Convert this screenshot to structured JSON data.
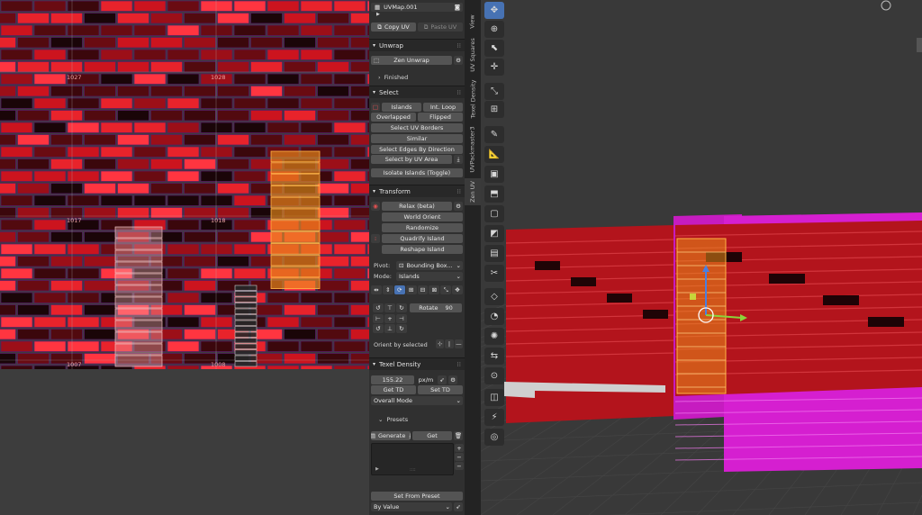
{
  "uv_editor": {
    "tile_labels": [
      "1027",
      "1028",
      "1017",
      "1018",
      "1007",
      "1008"
    ]
  },
  "panel": {
    "uvmap_name": "UVMap.001",
    "copy_uv": "Copy UV",
    "paste_uv": "Paste UV",
    "unwrap": {
      "title": "Unwrap",
      "zen_unwrap": "Zen Unwrap",
      "finished": "Finished"
    },
    "select": {
      "title": "Select",
      "islands": "Islands",
      "int_loop": "Int. Loop",
      "overlapped": "Overlapped",
      "flipped": "Flipped",
      "uv_borders": "Select UV Borders",
      "similar": "Similar",
      "edges_by_direction": "Select Edges By Direction",
      "by_uv_area": "Select by UV Area",
      "isolate": "Isolate Islands (Toggle)"
    },
    "transform": {
      "title": "Transform",
      "relax": "Relax (beta)",
      "world_orient": "World Orient",
      "randomize": "Randomize",
      "quadrify": "Quadrify Island",
      "reshape": "Reshape Island",
      "pivot_label": "Pivot:",
      "pivot_value": "Bounding Box...",
      "mode_label": "Mode:",
      "mode_value": "Islands",
      "rotate_label": "Rotate",
      "rotate_value": "90",
      "orient_by_selected": "Orient by selected"
    },
    "texel_density": {
      "title": "Texel Density",
      "value": "155.22",
      "unit": "px/m",
      "get_td": "Get TD",
      "set_td": "Set TD",
      "mode": "Overall Mode",
      "presets": "Presets",
      "generate": "Generate",
      "get": "Get",
      "set_from_preset": "Set From Preset",
      "by_value": "By Value"
    }
  },
  "tabs": [
    "View",
    "UV Squares",
    "Texel Density",
    "UVPackmaster3",
    "Zen UV"
  ],
  "toolbar": [
    "select-box",
    "cursor",
    "move",
    "rotate",
    "scale",
    "transform",
    "annotate",
    "measure",
    "add-cube",
    "extrude",
    "inset",
    "bevel",
    "loop-cut",
    "knife",
    "poly-build",
    "spin",
    "smooth",
    "edge-slide",
    "shrink-fatten",
    "shear",
    "rip",
    "to-sphere"
  ],
  "colors": {
    "accent": "#4772b3",
    "brick": "#d0161e",
    "selection": "#e88a1a",
    "magenta": "#d51fd0"
  }
}
